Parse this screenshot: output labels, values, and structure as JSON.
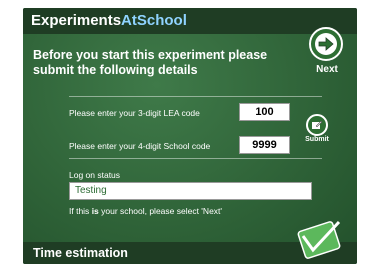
{
  "header": {
    "brand_main": "Experiments",
    "brand_accent": "AtSchool"
  },
  "intro": {
    "text": "Before you start this experiment please submit the following details"
  },
  "nav": {
    "next_label": "Next",
    "next_icon": "arrow-right-icon"
  },
  "form": {
    "lea_label": "Please enter your 3-digit LEA code",
    "lea_value": "100",
    "school_label": "Please enter your 4-digit School code",
    "school_value": "9999",
    "submit_label": "Submit",
    "submit_icon": "pencil-icon"
  },
  "status": {
    "label": "Log on status",
    "value": "Testing",
    "hint_before": "If this ",
    "hint_bold": "is",
    "hint_after": " your school, please select 'Next'"
  },
  "footer": {
    "title": "Time estimation"
  },
  "logo": {
    "text": "ExperimentsAtSchool"
  },
  "colors": {
    "board": "#2f6338",
    "header_bar": "#1f3d24",
    "accent": "#8fd3ff",
    "button": "#2d6e33"
  }
}
